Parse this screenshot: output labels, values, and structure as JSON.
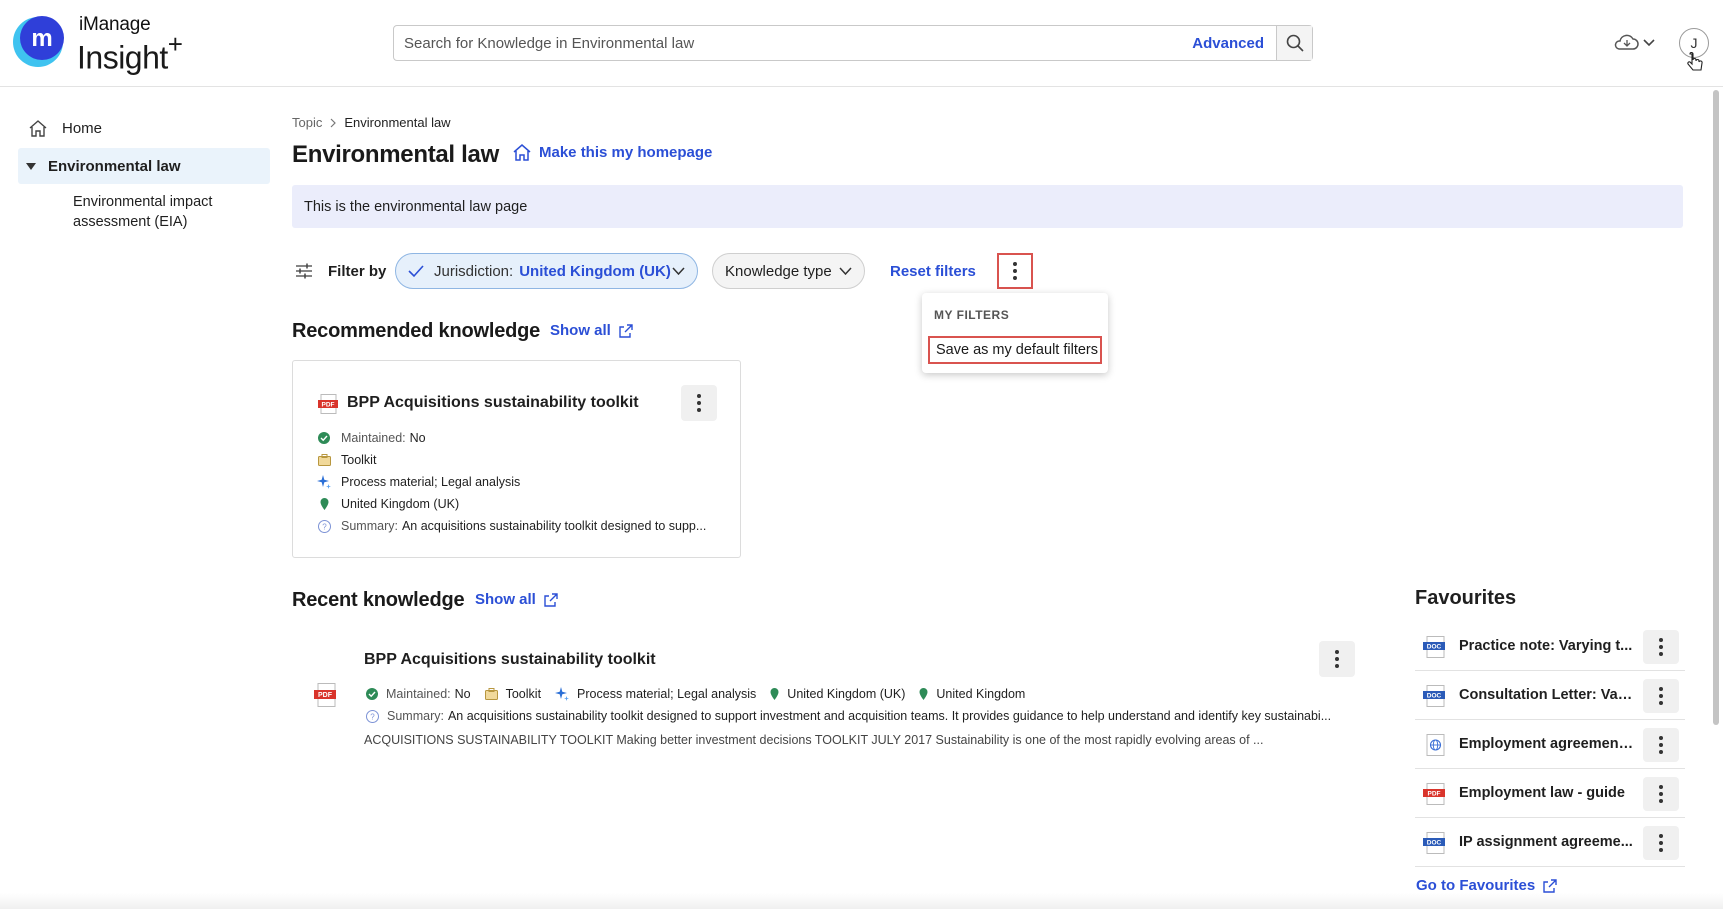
{
  "app": {
    "brand_top": "iManage",
    "brand_main": "Insight",
    "brand_plus": "+",
    "avatar_initial": "J"
  },
  "search": {
    "placeholder": "Search for Knowledge in Environmental law",
    "advanced_label": "Advanced"
  },
  "sidebar": {
    "home_label": "Home",
    "active_label": "Environmental law",
    "sub_items": [
      "Environmental impact assessment (EIA)"
    ]
  },
  "breadcrumb": {
    "parent": "Topic",
    "current": "Environmental law"
  },
  "page": {
    "title": "Environmental law",
    "homepage_link": "Make this my homepage",
    "banner_text": "This is the environmental law page"
  },
  "filters": {
    "label": "Filter by",
    "jurisdiction_key": "Jurisdiction:",
    "jurisdiction_value": "United Kingdom (UK)",
    "knowledge_type": "Knowledge type",
    "reset": "Reset filters",
    "menu_header": "MY FILTERS",
    "menu_item": "Save as my default filters"
  },
  "recommended": {
    "title": "Recommended knowledge",
    "show_all": "Show all",
    "card": {
      "title": "BPP Acquisitions sustainability toolkit",
      "maintained_label": "Maintained:",
      "maintained_value": "No",
      "type": "Toolkit",
      "categories": "Process material; Legal analysis",
      "jurisdiction": "United Kingdom (UK)",
      "summary_label": "Summary:",
      "summary": "An acquisitions sustainability toolkit designed to supp..."
    }
  },
  "recent": {
    "title": "Recent knowledge",
    "show_all": "Show all",
    "item": {
      "title": "BPP Acquisitions sustainability toolkit",
      "maintained_label": "Maintained:",
      "maintained_value": "No",
      "type": "Toolkit",
      "categories": "Process material; Legal analysis",
      "jurisdiction1": "United Kingdom (UK)",
      "jurisdiction2": "United Kingdom",
      "summary_label": "Summary:",
      "summary": "An acquisitions sustainability toolkit designed to support investment and acquisition teams. It provides guidance to help understand and identify key sustainabi...",
      "excerpt": "ACQUISITIONS SUSTAINABILITY TOOLKIT Making better investment decisions TOOLKIT JULY 2017 Sustainability is one of the most rapidly evolving areas of ..."
    }
  },
  "favourites": {
    "title": "Favourites",
    "items": [
      {
        "label": "Practice note: Varying t...",
        "icon": "doc-icon"
      },
      {
        "label": "Consultation Letter: Var...",
        "icon": "doc-icon"
      },
      {
        "label": "Employment agreement...",
        "icon": "web-icon"
      },
      {
        "label": "Employment law - guide",
        "icon": "pdf-icon"
      },
      {
        "label": "IP assignment agreeme...",
        "icon": "doc-icon"
      }
    ],
    "go_link": "Go to Favourites"
  },
  "colors": {
    "link": "#2b4fd6",
    "highlight": "#d9534f",
    "banner": "#ebedfb",
    "chip_active": "#e6f0fb"
  }
}
